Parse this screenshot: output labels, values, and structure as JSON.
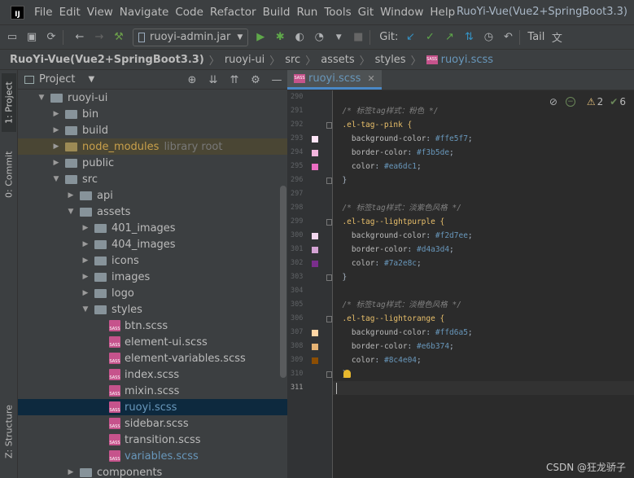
{
  "window_title": "RuoYi-Vue(Vue2+SpringBoot3.3)",
  "menu": [
    "File",
    "Edit",
    "View",
    "Navigate",
    "Code",
    "Refactor",
    "Build",
    "Run",
    "Tools",
    "Git",
    "Window",
    "Help"
  ],
  "toolbar": {
    "run_config": "ruoyi-admin.jar",
    "vcs_label": "Git:",
    "tail_label": "Tail"
  },
  "breadcrumb": {
    "root": "RuoYi-Vue(Vue2+SpringBoot3.3)",
    "parts": [
      "ruoyi-ui",
      "src",
      "assets",
      "styles"
    ],
    "file": "ruoyi.scss"
  },
  "left_stripe": {
    "project_tab": "1: Project",
    "commit_tab": "0: Commit",
    "structure_tab": "Z: Structure"
  },
  "project_panel": {
    "title": "Project",
    "tree": [
      {
        "label": "ruoyi-ui",
        "indent": 0,
        "type": "folder",
        "expanded": true
      },
      {
        "label": "bin",
        "indent": 1,
        "type": "folder"
      },
      {
        "label": "build",
        "indent": 1,
        "type": "folder"
      },
      {
        "label": "node_modules",
        "indent": 1,
        "type": "folder",
        "excluded": true,
        "note": "library root"
      },
      {
        "label": "public",
        "indent": 1,
        "type": "folder"
      },
      {
        "label": "src",
        "indent": 1,
        "type": "folder",
        "expanded": true
      },
      {
        "label": "api",
        "indent": 2,
        "type": "folder"
      },
      {
        "label": "assets",
        "indent": 2,
        "type": "folder",
        "expanded": true
      },
      {
        "label": "401_images",
        "indent": 3,
        "type": "folder"
      },
      {
        "label": "404_images",
        "indent": 3,
        "type": "folder"
      },
      {
        "label": "icons",
        "indent": 3,
        "type": "folder"
      },
      {
        "label": "images",
        "indent": 3,
        "type": "folder"
      },
      {
        "label": "logo",
        "indent": 3,
        "type": "folder"
      },
      {
        "label": "styles",
        "indent": 3,
        "type": "folder",
        "expanded": true
      },
      {
        "label": "btn.scss",
        "indent": 4,
        "type": "sass"
      },
      {
        "label": "element-ui.scss",
        "indent": 4,
        "type": "sass"
      },
      {
        "label": "element-variables.scss",
        "indent": 4,
        "type": "sass"
      },
      {
        "label": "index.scss",
        "indent": 4,
        "type": "sass"
      },
      {
        "label": "mixin.scss",
        "indent": 4,
        "type": "sass"
      },
      {
        "label": "ruoyi.scss",
        "indent": 4,
        "type": "sass",
        "selected": true
      },
      {
        "label": "sidebar.scss",
        "indent": 4,
        "type": "sass"
      },
      {
        "label": "transition.scss",
        "indent": 4,
        "type": "sass"
      },
      {
        "label": "variables.scss",
        "indent": 4,
        "type": "sass",
        "modified": true
      },
      {
        "label": "components",
        "indent": 2,
        "type": "folder"
      }
    ]
  },
  "editor": {
    "tab_label": "ruoyi.scss",
    "inspection": {
      "warnings": "2",
      "ok": "6"
    },
    "lines": [
      {
        "n": "290",
        "text": ""
      },
      {
        "n": "291",
        "kind": "comment",
        "text": "/* 标签tag样式：粉色 */"
      },
      {
        "n": "292",
        "kind": "selector",
        "text": ".el-tag--pink {"
      },
      {
        "n": "293",
        "kind": "decl",
        "prop": "background-color",
        "value": "#ffe5f7",
        "swatch": "#ffe5f7"
      },
      {
        "n": "294",
        "kind": "decl",
        "prop": "border-color",
        "value": "#f3b5de",
        "swatch": "#f3b5de"
      },
      {
        "n": "295",
        "kind": "decl",
        "prop": "color",
        "value": "#ea6dc1",
        "swatch": "#ea6dc1"
      },
      {
        "n": "296",
        "kind": "close",
        "text": "}"
      },
      {
        "n": "297",
        "text": ""
      },
      {
        "n": "298",
        "kind": "comment",
        "text": "/* 标签tag样式：淡紫色风格 */"
      },
      {
        "n": "299",
        "kind": "selector",
        "text": ".el-tag--lightpurple {"
      },
      {
        "n": "300",
        "kind": "decl",
        "prop": "background-color",
        "value": "#f2d7ee",
        "swatch": "#f2d7ee"
      },
      {
        "n": "301",
        "kind": "decl",
        "prop": "border-color",
        "value": "#d4a3d4",
        "swatch": "#d4a3d4"
      },
      {
        "n": "302",
        "kind": "decl",
        "prop": "color",
        "value": "#7a2e8c",
        "swatch": "#7a2e8c"
      },
      {
        "n": "303",
        "kind": "close",
        "text": "}"
      },
      {
        "n": "304",
        "text": ""
      },
      {
        "n": "305",
        "kind": "comment",
        "text": "/* 标签tag样式：淡橙色风格 */"
      },
      {
        "n": "306",
        "kind": "selector",
        "text": ".el-tag--lightorange {"
      },
      {
        "n": "307",
        "kind": "decl",
        "prop": "background-color",
        "value": "#ffd6a5",
        "swatch": "#ffd6a5"
      },
      {
        "n": "308",
        "kind": "decl",
        "prop": "border-color",
        "value": "#e6b374",
        "swatch": "#e6b374"
      },
      {
        "n": "309",
        "kind": "decl",
        "prop": "color",
        "value": "#8c4e04",
        "swatch": "#8c4e04"
      },
      {
        "n": "310",
        "kind": "close",
        "text": "}"
      },
      {
        "n": "311",
        "text": "",
        "current": true
      }
    ]
  },
  "watermark": "CSDN @狂龙骄子"
}
